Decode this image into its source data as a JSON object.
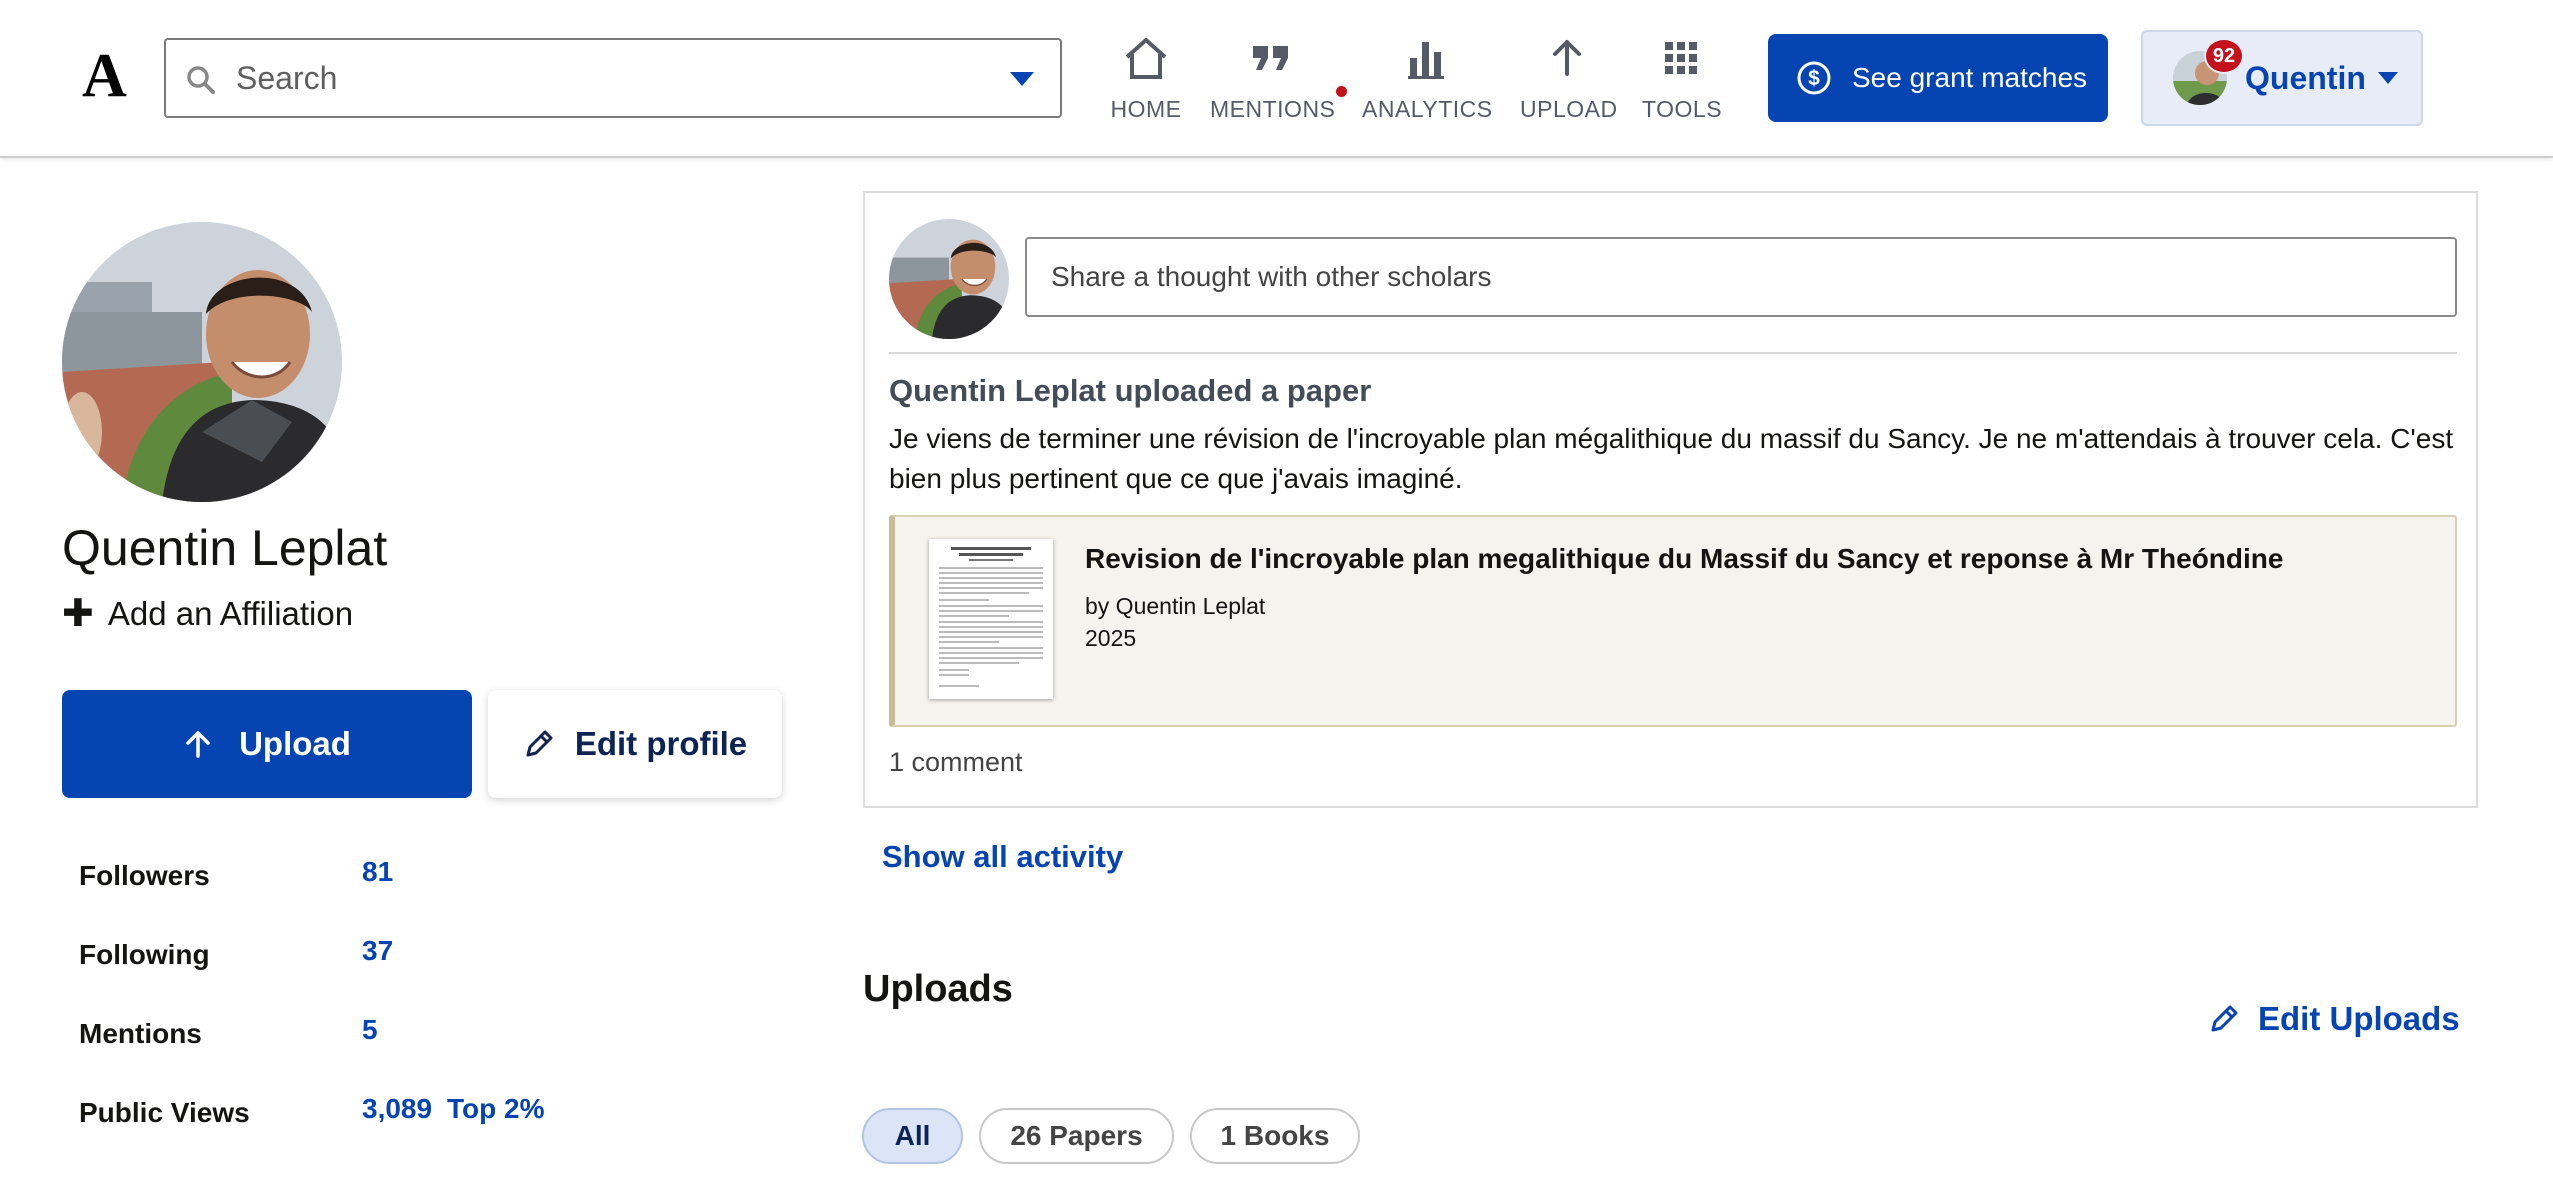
{
  "header": {
    "logo": "A",
    "search": {
      "placeholder": "Search"
    },
    "nav": [
      {
        "label": "HOME",
        "icon": "home-icon"
      },
      {
        "label": "MENTIONS",
        "icon": "quote-icon",
        "notification_dot": true
      },
      {
        "label": "ANALYTICS",
        "icon": "bar-chart-icon"
      },
      {
        "label": "UPLOAD",
        "icon": "arrow-up-icon"
      },
      {
        "label": "TOOLS",
        "icon": "grid-icon"
      }
    ],
    "grant_button": "See grant matches",
    "user": {
      "name": "Quentin",
      "badge_count": "92"
    }
  },
  "profile": {
    "name": "Quentin Leplat",
    "add_affiliation": "Add an Affiliation",
    "upload_label": "Upload",
    "edit_profile_label": "Edit profile",
    "stats": [
      {
        "label": "Followers",
        "value": "81"
      },
      {
        "label": "Following",
        "value": "37"
      },
      {
        "label": "Mentions",
        "value": "5"
      },
      {
        "label": "Public Views",
        "value": "3,089",
        "extra": "Top 2%"
      }
    ]
  },
  "feed": {
    "share_placeholder": "Share a thought with other scholars",
    "activity_title": "Quentin Leplat uploaded a paper",
    "activity_text": "Je viens de terminer une révision de l'incroyable plan  mégalithique du massif du Sancy. Je ne m'attendais à trouver cela. C'est bien plus pertinent que ce que j'avais imaginé.",
    "paper": {
      "title": "Revision de l'incroyable plan megalithique du Massif du Sancy et reponse à Mr Theóndine",
      "author": "by Quentin Leplat",
      "year": "2025"
    },
    "comments": "1 comment"
  },
  "show_all_activity": "Show all activity",
  "uploads": {
    "heading": "Uploads",
    "edit_label": "Edit Uploads",
    "filters": [
      {
        "label": "All",
        "active": true
      },
      {
        "label": "26 Papers",
        "active": false
      },
      {
        "label": "1 Books",
        "active": false
      }
    ]
  },
  "colors": {
    "brand_blue": "#0645b1",
    "notification_red": "#c4121d",
    "paper_card_bg": "#f5f3ee"
  }
}
